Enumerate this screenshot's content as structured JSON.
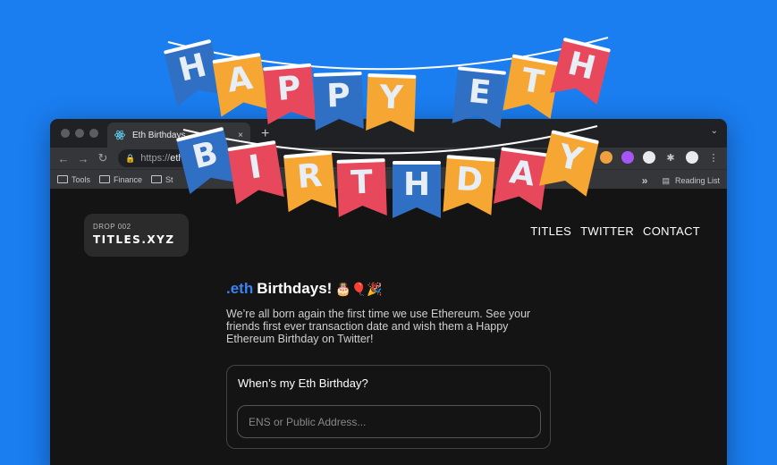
{
  "browser": {
    "tab_title": "Eth Birthdays",
    "tab_close": "×",
    "new_tab": "+",
    "url_scheme": "https://",
    "url_host": "ethb",
    "bookmarks": [
      "Tools",
      "Finance",
      "St"
    ],
    "reading_list": "Reading List",
    "more_bookmarks": "»"
  },
  "page": {
    "logo": {
      "drop": "DROP 002",
      "brand": "TITLES.XYZ"
    },
    "nav": [
      "TITLES",
      "TWITTER",
      "CONTACT"
    ],
    "headline": {
      "eth": ".eth",
      "rest": "Birthdays!",
      "emojis": "🎂🎈🎉"
    },
    "description": "We’re all born again the first time we use Ethereum. See your friends first ever transaction date and wish them a Happy Ethereum Birthday on Twitter!",
    "form": {
      "label": "When’s my Eth Birthday?",
      "placeholder": "ENS or Public Address..."
    }
  },
  "banner": {
    "row1": [
      "H",
      "A",
      "P",
      "P",
      "Y",
      "E",
      "T",
      "H"
    ],
    "row2": [
      "B",
      "I",
      "R",
      "T",
      "H",
      "D",
      "A",
      "Y"
    ],
    "colors": {
      "blue": "#2f6fc4",
      "orange": "#f6a632",
      "red": "#e8485b"
    }
  },
  "colors": {
    "background": "#1a7df0",
    "accent": "#3b82f6",
    "page_bg": "#141414"
  }
}
